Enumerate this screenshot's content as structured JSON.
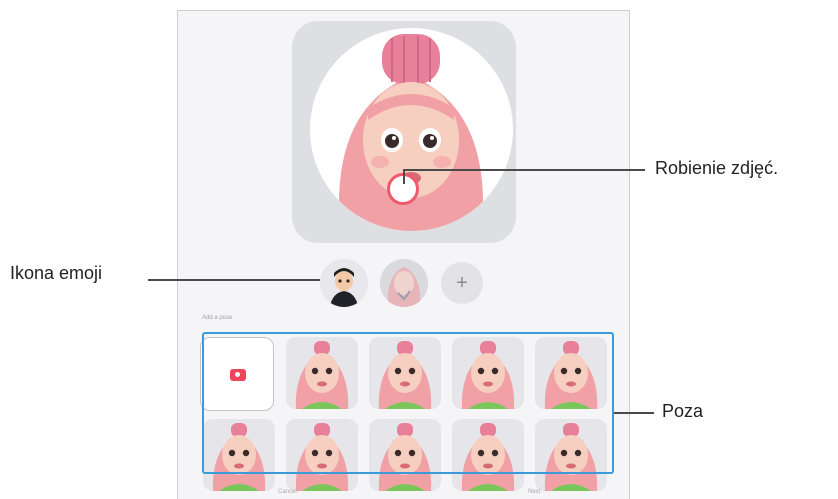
{
  "callouts": {
    "shutter": "Robienie zdjęć.",
    "emoji": "Ikona emoji",
    "pose": "Poza"
  },
  "screen": {
    "add_button_label": "+",
    "section_label": "Add a pose",
    "bottom_left_button": "Cancel",
    "bottom_right_button": "Next"
  },
  "colors": {
    "accent": "#3b9bd8",
    "shutter_ring": "#f0596b",
    "camera_icon": "#f0445a",
    "hair": "#f1a1a6"
  },
  "icons": {
    "camera": "camera-icon",
    "add": "plus-icon",
    "palette": "color-wheel-icon"
  }
}
